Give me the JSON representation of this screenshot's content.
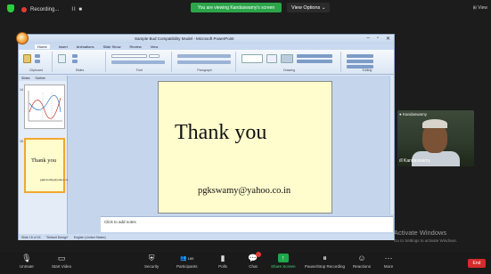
{
  "zoom": {
    "recording_label": "Recording...",
    "recording_controls": "II ■",
    "viewing_banner": "You are viewing Kandaswamy's screen",
    "view_options": "View Options ⌄",
    "view_right": "⊞ View"
  },
  "powerpoint": {
    "window_title": "Sample Bud Compatibility Model - Microsoft PowerPoint",
    "ribbon_tabs": [
      "Home",
      "Insert",
      "Animations",
      "Slide Show",
      "Review",
      "View"
    ],
    "groups": [
      "Clipboard",
      "Slides",
      "Font",
      "Paragraph",
      "Drawing",
      "Editing"
    ],
    "panel_tabs": [
      "Slides",
      "Outline"
    ],
    "slide_numbers": [
      "14",
      "15"
    ],
    "thumb_text": "Thank you",
    "thumb_email": "pgkswamy@yahoo.co.in",
    "slide": {
      "title": "Thank you",
      "email": "pgkswamy@yahoo.co.in"
    },
    "notes_placeholder": "Click to add notes",
    "status": [
      "Slide 15 of 15",
      "\"Default Design\"",
      "English (United States)"
    ]
  },
  "activate_windows": {
    "title": "Activate Windows",
    "subtitle": "Go to Settings to activate Windows."
  },
  "participant": {
    "tag": "● Kandaswamy",
    "name": "ıll Kandaswamy"
  },
  "toolbar": {
    "unmute": "Unmute",
    "start_video": "Start Video",
    "security": "Security",
    "participants": "Participants",
    "participants_count": "189",
    "polls": "Polls",
    "chat": "Chat",
    "share_screen": "Share Screen",
    "pause_recording": "Pause/Stop Recording",
    "reactions": "Reactions",
    "more": "More",
    "end": "End"
  },
  "colors": {
    "zoom_bg": "#1c1c1c",
    "viewing_green": "#2ca54a",
    "slide_bg": "#fffccd",
    "end_red": "#d42b2b"
  }
}
